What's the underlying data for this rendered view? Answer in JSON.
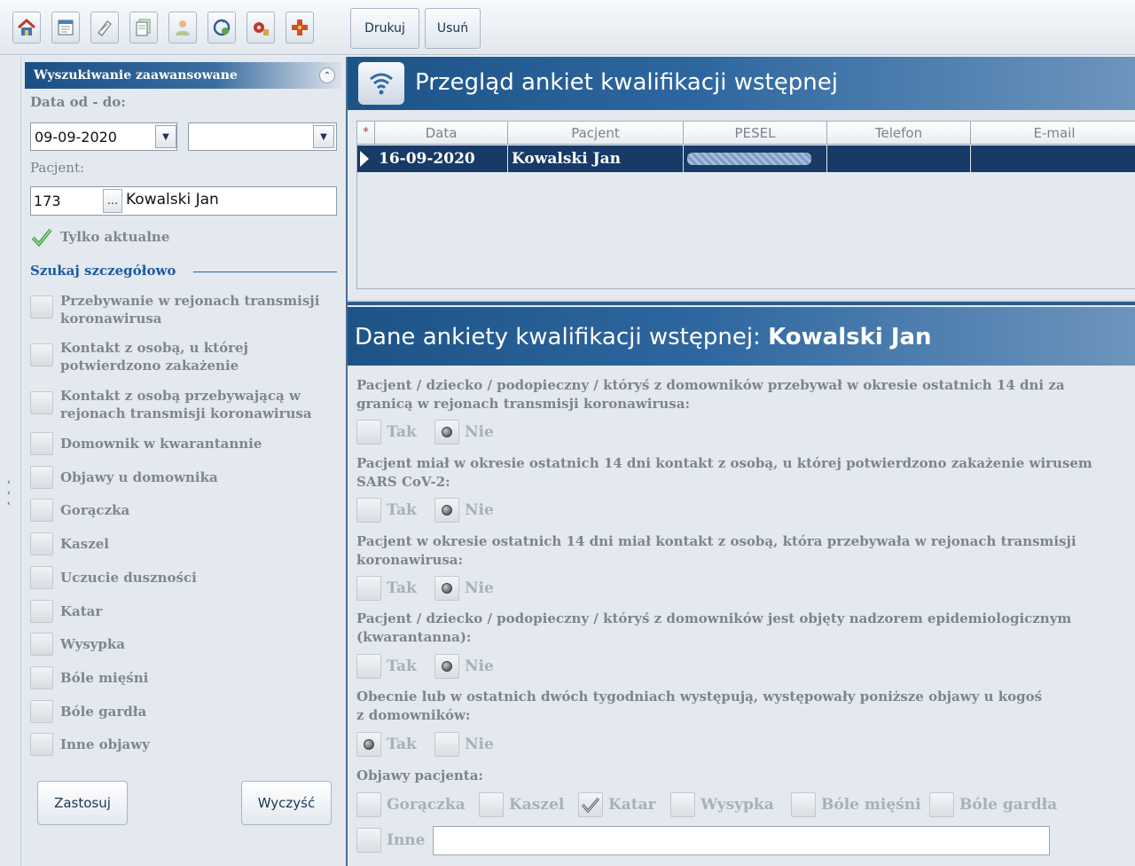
{
  "toolbar": {
    "icons": [
      "home-icon",
      "calendar-icon",
      "notes-icon",
      "documents-icon",
      "patients-icon",
      "refresh-icon",
      "medical-settings-icon",
      "medical-cross-icon"
    ],
    "print_label": "Drukuj",
    "delete_label": "Usuń"
  },
  "search": {
    "header": "Wyszukiwanie zaawansowane",
    "date_label": "Data od - do:",
    "date_from": "09-09-2020",
    "date_to": "",
    "patient_label": "Pacjent:",
    "patient_id": "173",
    "patient_browse": "...",
    "patient_name": "Kowalski Jan",
    "only_current_label": "Tylko aktualne",
    "only_current_checked": true,
    "detailed_label": "Szukaj szczegółowo",
    "filters": [
      "Przebywanie w rejonach transmisji koronawirusa",
      "Kontakt z osobą, u której potwierdzono zakażenie",
      "Kontakt z osobą przebywającą w rejonach transmisji koronawirusa",
      "Domownik w kwarantannie",
      "Objawy u domownika",
      "Gorączka",
      "Kaszel",
      "Uczucie duszności",
      "Katar",
      "Wysypka",
      "Bóle mięśni",
      "Bóle gardła",
      "Inne objawy"
    ],
    "apply_label": "Zastosuj",
    "clear_label": "Wyczyść"
  },
  "list": {
    "title": "Przegląd ankiet kwalifikacji wstępnej",
    "star": "*",
    "columns": [
      "Data",
      "Pacjent",
      "PESEL",
      "Telefon",
      "E-mail"
    ],
    "rows": [
      {
        "date": "16-09-2020",
        "patient": "Kowalski Jan",
        "pesel": "",
        "phone": "",
        "email": ""
      }
    ]
  },
  "details": {
    "title_prefix": "Dane ankiety kwalifikacji wstępnej: ",
    "title_name": "Kowalski Jan",
    "questions": [
      {
        "text": "Pacjent / dziecko / podopieczny / któryś z domowników przebywał w okresie ostatnich 14 dni za granicą w rejonach transmisji koronawirusa:",
        "answer": "Nie"
      },
      {
        "text": "Pacjent miał w okresie ostatnich 14 dni kontakt z osobą, u której potwierdzono zakażenie wirusem SARS CoV-2:",
        "answer": "Nie"
      },
      {
        "text": "Pacjent w okresie ostatnich 14 dni miał kontakt z osobą, która przebywała w rejonach transmisji koronawirusa:",
        "answer": "Nie"
      },
      {
        "text": "Pacjent / dziecko / podopieczny / któryś z domowników jest objęty nadzorem epidemiologicznym (kwarantanna):",
        "answer": "Nie"
      },
      {
        "text": "Obecnie lub w ostatnich dwóch tygodniach występują, występowały poniższe objawy u kogoś z domowników:",
        "answer": "Tak"
      }
    ],
    "yes_label": "Tak",
    "no_label": "Nie",
    "symptoms_label": "Objawy pacjenta:",
    "symptoms": [
      {
        "label": "Gorączka",
        "checked": false
      },
      {
        "label": "Kaszel",
        "checked": false
      },
      {
        "label": "Katar",
        "checked": true
      },
      {
        "label": "Wysypka",
        "checked": false
      },
      {
        "label": "Bóle mięśni",
        "checked": false
      },
      {
        "label": "Bóle gardła",
        "checked": false
      }
    ],
    "other_label": "Inne",
    "other_value": ""
  }
}
